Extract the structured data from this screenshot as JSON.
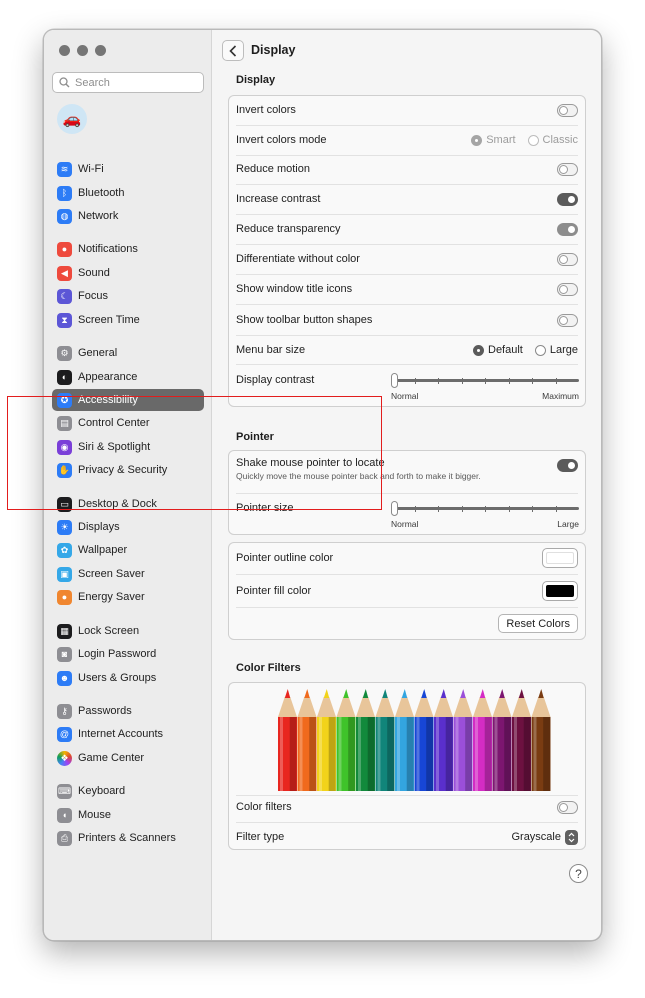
{
  "window": {
    "title": "Display"
  },
  "sidebar": {
    "search_placeholder": "Search",
    "avatar_emoji": "🚗",
    "items": [
      {
        "label": "Wi-Fi",
        "icon": "wifi-icon",
        "color": "#2d7cf6",
        "glyph": "≋"
      },
      {
        "label": "Bluetooth",
        "icon": "bluetooth-icon",
        "color": "#2d7cf6",
        "glyph": "ᛒ"
      },
      {
        "label": "Network",
        "icon": "globe-icon",
        "color": "#2d7cf6",
        "glyph": "◍"
      },
      {
        "label": "Notifications",
        "icon": "bell-icon",
        "color": "#ee4a3d",
        "glyph": "●"
      },
      {
        "label": "Sound",
        "icon": "speaker-icon",
        "color": "#ee4a3d",
        "glyph": "◀"
      },
      {
        "label": "Focus",
        "icon": "moon-icon",
        "color": "#5c56d6",
        "glyph": "☾"
      },
      {
        "label": "Screen Time",
        "icon": "hourglass-icon",
        "color": "#5c56d6",
        "glyph": "⧗"
      },
      {
        "label": "General",
        "icon": "gear-icon",
        "color": "#8e8e93",
        "glyph": "⚙"
      },
      {
        "label": "Appearance",
        "icon": "appearance-icon",
        "color": "#1c1c1e",
        "glyph": "◐"
      },
      {
        "label": "Accessibility",
        "icon": "accessibility-icon",
        "color": "#2d7cf6",
        "glyph": "✪"
      },
      {
        "label": "Control Center",
        "icon": "control-center-icon",
        "color": "#8e8e93",
        "glyph": "▤"
      },
      {
        "label": "Siri & Spotlight",
        "icon": "siri-icon",
        "color": "#7a3fd8",
        "glyph": "◉"
      },
      {
        "label": "Privacy & Security",
        "icon": "hand-icon",
        "color": "#2d7cf6",
        "glyph": "✋"
      },
      {
        "label": "Desktop & Dock",
        "icon": "dock-icon",
        "color": "#1c1c1e",
        "glyph": "▭"
      },
      {
        "label": "Displays",
        "icon": "sun-icon",
        "color": "#2d7cf6",
        "glyph": "☀"
      },
      {
        "label": "Wallpaper",
        "icon": "flower-icon",
        "color": "#35a8e8",
        "glyph": "✿"
      },
      {
        "label": "Screen Saver",
        "icon": "screen-saver-icon",
        "color": "#35a8e8",
        "glyph": "▣"
      },
      {
        "label": "Energy Saver",
        "icon": "bulb-icon",
        "color": "#f0862f",
        "glyph": "●"
      },
      {
        "label": "Lock Screen",
        "icon": "lock-icon",
        "color": "#1c1c1e",
        "glyph": "▦"
      },
      {
        "label": "Login Password",
        "icon": "padlock-icon",
        "color": "#8e8e93",
        "glyph": "◙"
      },
      {
        "label": "Users & Groups",
        "icon": "users-icon",
        "color": "#2d7cf6",
        "glyph": "☻"
      },
      {
        "label": "Passwords",
        "icon": "key-icon",
        "color": "#8e8e93",
        "glyph": "⚷"
      },
      {
        "label": "Internet Accounts",
        "icon": "at-icon",
        "color": "#2d7cf6",
        "glyph": "@"
      },
      {
        "label": "Game Center",
        "icon": "game-center-icon",
        "color": "#ffffff",
        "glyph": "❖"
      },
      {
        "label": "Keyboard",
        "icon": "keyboard-icon",
        "color": "#8e8e93",
        "glyph": "⌨"
      },
      {
        "label": "Mouse",
        "icon": "mouse-icon",
        "color": "#8e8e93",
        "glyph": "◖"
      },
      {
        "label": "Printers & Scanners",
        "icon": "printer-icon",
        "color": "#8e8e93",
        "glyph": "⎙"
      }
    ],
    "selected": "Accessibility"
  },
  "display_section": {
    "title": "Display",
    "invert_colors": {
      "label": "Invert colors",
      "on": false
    },
    "invert_colors_mode": {
      "label": "Invert colors mode",
      "options": [
        "Smart",
        "Classic"
      ],
      "selected": "Smart"
    },
    "reduce_motion": {
      "label": "Reduce motion",
      "on": false
    },
    "increase_contrast": {
      "label": "Increase contrast",
      "on": true
    },
    "reduce_transparency": {
      "label": "Reduce transparency",
      "on": true
    },
    "differentiate_without_color": {
      "label": "Differentiate without color",
      "on": false
    },
    "show_window_title_icons": {
      "label": "Show window title icons",
      "on": false
    },
    "show_toolbar_button_shapes": {
      "label": "Show toolbar button shapes",
      "on": false
    },
    "menu_bar_size": {
      "label": "Menu bar size",
      "options": [
        "Default",
        "Large"
      ],
      "selected": "Default"
    },
    "display_contrast": {
      "label": "Display contrast",
      "min_label": "Normal",
      "max_label": "Maximum",
      "value": 0
    }
  },
  "pointer_section": {
    "title": "Pointer",
    "shake_to_locate": {
      "label": "Shake mouse pointer to locate",
      "description": "Quickly move the mouse pointer back and forth to make it bigger.",
      "on": true
    },
    "pointer_size": {
      "label": "Pointer size",
      "min_label": "Normal",
      "max_label": "Large",
      "value": 0
    },
    "outline_color": {
      "label": "Pointer outline color",
      "color": "#ffffff"
    },
    "fill_color": {
      "label": "Pointer fill color",
      "color": "#000000"
    },
    "reset_label": "Reset Colors"
  },
  "color_filters_section": {
    "title": "Color Filters",
    "pencil_colors": [
      "#e8261f",
      "#f06a1d",
      "#f2d31a",
      "#3fc32a",
      "#128a3c",
      "#11857a",
      "#33a5e0",
      "#1746d6",
      "#5a2fcc",
      "#9b4fd9",
      "#d42cc4",
      "#7c1670",
      "#6d1140",
      "#7a3c12"
    ],
    "color_filters": {
      "label": "Color filters",
      "on": false
    },
    "filter_type": {
      "label": "Filter type",
      "value": "Grayscale"
    }
  }
}
